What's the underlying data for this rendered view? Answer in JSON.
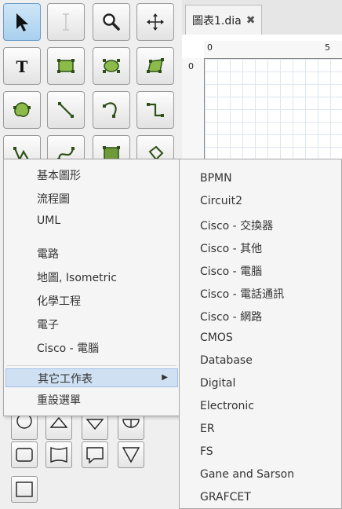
{
  "tab": {
    "title": "圖表1.dia",
    "close_icon": "close-icon"
  },
  "ruler": {
    "h_labels": [
      "0",
      "5"
    ],
    "v_labels": [
      "0"
    ]
  },
  "tools": [
    {
      "name": "pointer-icon"
    },
    {
      "name": "text-cursor-icon"
    },
    {
      "name": "magnify-icon"
    },
    {
      "name": "move-icon"
    },
    {
      "name": "text-tool-icon"
    },
    {
      "name": "box-icon"
    },
    {
      "name": "ellipse-icon"
    },
    {
      "name": "polygon-icon"
    },
    {
      "name": "beziergon-icon"
    },
    {
      "name": "line-icon"
    },
    {
      "name": "arc-icon"
    },
    {
      "name": "zigzag-line-icon"
    },
    {
      "name": "polyline-icon"
    },
    {
      "name": "bezier-line-icon"
    },
    {
      "name": "image-icon"
    },
    {
      "name": "outline-icon"
    }
  ],
  "sheet_menu": {
    "items": [
      "基本圖形",
      "流程圖",
      "UML",
      "電路",
      "地圖, Isometric",
      "化學工程",
      "電子",
      "Cisco - 電腦"
    ],
    "other_sheets": "其它工作表",
    "reset_menu": "重設選單"
  },
  "submenu": {
    "items": [
      "BPMN",
      "Circuit2",
      "Cisco - 交換器",
      "Cisco - 其他",
      "Cisco - 電腦",
      "Cisco - 電話通訊",
      "Cisco - 網路",
      "CMOS",
      "Database",
      "Digital",
      "Electronic",
      "ER",
      "FS",
      "Gane and Sarson",
      "GRAFCET"
    ]
  }
}
